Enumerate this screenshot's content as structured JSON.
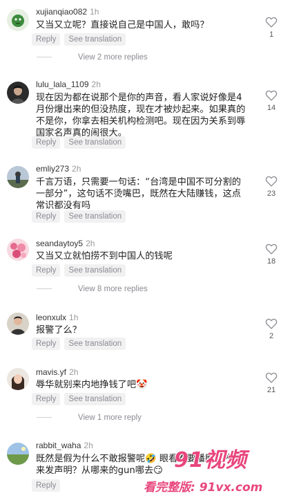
{
  "comments": [
    {
      "username": "xujianqiao082",
      "time": "1h",
      "text": "又当又立呢？直接说自己是中国人，敢吗？",
      "reply_label": "Reply",
      "translate_label": "See translation",
      "likes": "1",
      "view_more": "View 2 more replies",
      "avatar": "green-character-avatar"
    },
    {
      "username": "lulu_lala_1109",
      "time": "2h",
      "text": "现在因为都在说那个是你的声音，看人家说好像是4月份爆出来的但没热度，现在才被炒起来。如果真的不是你，你拿去相关机构检测吧。现在因为关系到辱国家名声真的闹很大。",
      "reply_label": "Reply",
      "translate_label": "See translation",
      "likes": "14",
      "avatar": "dark-portrait-avatar"
    },
    {
      "username": "emliy273",
      "time": "2h",
      "text": "千言万语，只需要一句话：“台湾是中国不可分割的一部分”，这句话不烫嘴巴，既然在大陆赚钱，这点常识都没有吗",
      "reply_label": "Reply",
      "translate_label": "See translation",
      "likes": "23",
      "avatar": "sky-figure-avatar"
    },
    {
      "username": "seandaytoy5",
      "time": "2h",
      "text": "又当又立就怕捞不到中国人的钱呢",
      "reply_label": "Reply",
      "translate_label": "See translation",
      "likes": "18",
      "view_more": "View 8 more replies",
      "avatar": "pink-flowers-avatar"
    },
    {
      "username": "leonxulx",
      "time": "1h",
      "text": "报警了么？",
      "reply_label": "Reply",
      "translate_label": "See translation",
      "likes": "2",
      "avatar": "person-portrait-avatar"
    },
    {
      "username": "mavis.yf",
      "time": "2h",
      "text": "辱华就别来内地挣钱了吧🤡",
      "reply_label": "Reply",
      "translate_label": "See translation",
      "likes": "21",
      "view_more": "View 1 more reply",
      "avatar": "woman-portrait-avatar"
    },
    {
      "username": "rabbit_waha",
      "time": "2h",
      "text": "既然是假为什么不敢报警呢🤣 眼看着要播剧了才出来发声明？从哪来的gun哪去😏",
      "reply_label": "Reply",
      "translate_label": "",
      "likes": "",
      "avatar": "landscape-avatar"
    }
  ],
  "watermark": {
    "logo": "91视频",
    "url": "看完整版: 91vx.com"
  },
  "colors": {
    "pill_bg": "#f1f1f2",
    "muted_text": "#8a8b91",
    "watermark": "#e8467c"
  },
  "icons": {
    "like": "heart-outline-icon"
  }
}
